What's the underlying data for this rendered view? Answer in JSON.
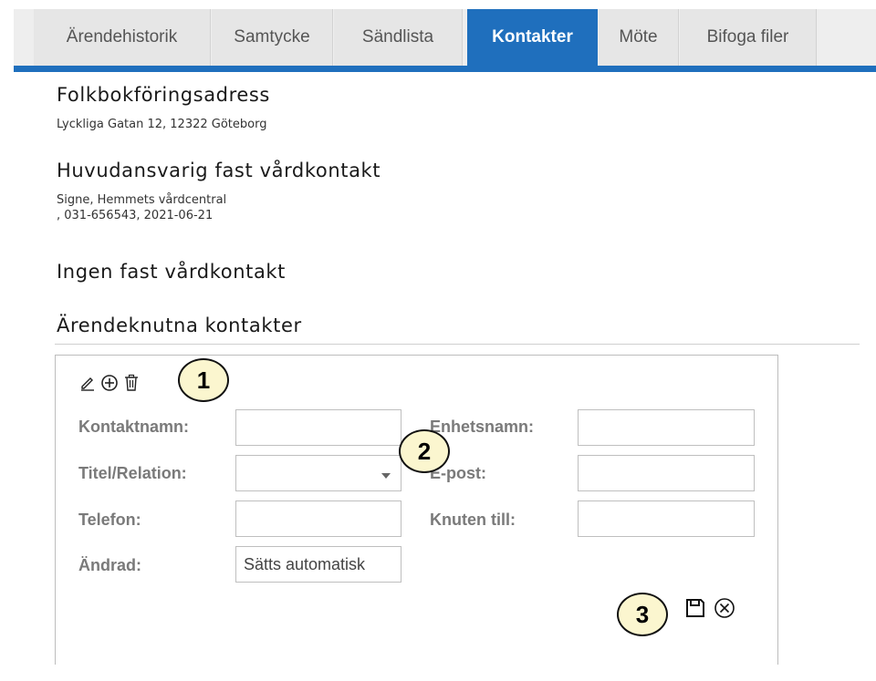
{
  "tabs": [
    {
      "label": "Ärendehistorik",
      "active": false
    },
    {
      "label": "Samtycke",
      "active": false
    },
    {
      "label": "Sändlista",
      "active": false
    },
    {
      "label": "Kontakter",
      "active": true
    },
    {
      "label": "Möte",
      "active": false
    },
    {
      "label": "Bifoga filer",
      "active": false
    }
  ],
  "colors": {
    "accent": "#1f6fbd",
    "callout_fill": "#fbf6cf",
    "label_gray": "#7a7a7a"
  },
  "folkbokforing": {
    "heading": "Folkbokföringsadress",
    "address": "Lyckliga Gatan 12, 12322 Göteborg"
  },
  "huvudansvarig": {
    "heading": "Huvudansvarig fast vårdkontakt",
    "line1": "Signe, Hemmets vårdcentral",
    "line2": ", 031-656543, 2021-06-21"
  },
  "ingen_fast": {
    "heading": "Ingen fast vårdkontakt"
  },
  "arendeknutna": {
    "heading": "Ärendeknutna kontakter"
  },
  "toolbar": {
    "icons": [
      "edit-icon",
      "add-circle-icon",
      "trash-icon"
    ]
  },
  "form": {
    "kontaktnamn": {
      "label": "Kontaktnamn:",
      "value": ""
    },
    "titel": {
      "label": "Titel/Relation:",
      "value": ""
    },
    "telefon": {
      "label": "Telefon:",
      "value": ""
    },
    "andrad": {
      "label": "Ändrad:",
      "value": "Sätts automatisk"
    },
    "enhetsnamn": {
      "label": "Enhetsnamn:",
      "value": ""
    },
    "epost": {
      "label": "E-post:",
      "value": ""
    },
    "knuten": {
      "label": "Knuten till:",
      "value": ""
    }
  },
  "actions": {
    "icons": [
      "save-icon",
      "cancel-icon"
    ]
  },
  "callouts": {
    "one": "1",
    "two": "2",
    "three": "3"
  }
}
